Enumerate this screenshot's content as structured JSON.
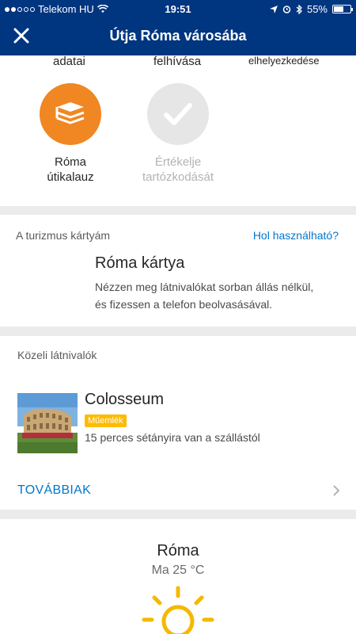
{
  "status": {
    "carrier": "Telekom HU",
    "time": "19:51",
    "battery": "55%"
  },
  "header": {
    "title": "Útja Róma városába",
    "close_icon": "close-icon"
  },
  "top_labels": [
    "adatai",
    "felhívása",
    "elhelyezkedése"
  ],
  "actions": [
    {
      "label_line1": "Róma",
      "label_line2": "útikalauz",
      "icon": "book-stack-icon",
      "enabled": true,
      "color": "#f08723"
    },
    {
      "label_line1": "Értékelje",
      "label_line2": "tartózkodását",
      "icon": "check-icon",
      "enabled": false,
      "color": "#e6e6e6"
    }
  ],
  "tourism_card": {
    "section_title": "A turizmus kártyám",
    "link": "Hol használható?",
    "title": "Róma kártya",
    "desc_line1": "Nézzen meg látnivalókat sorban állás nélkül,",
    "desc_line2": "és fizessen a telefon beolvasásával."
  },
  "nearby": {
    "section_title": "Közeli látnivalók",
    "item": {
      "title": "Colosseum",
      "badge": "Műemlék",
      "distance": "15 perces sétányira van a szállástól"
    },
    "more_label": "TOVÁBBIAK"
  },
  "weather": {
    "city": "Róma",
    "temp": "Ma 25 °C",
    "icon": "sun-icon"
  },
  "colors": {
    "header": "#003580",
    "accent_link": "#0077cc",
    "badge": "#febb02",
    "orange": "#f08723"
  }
}
